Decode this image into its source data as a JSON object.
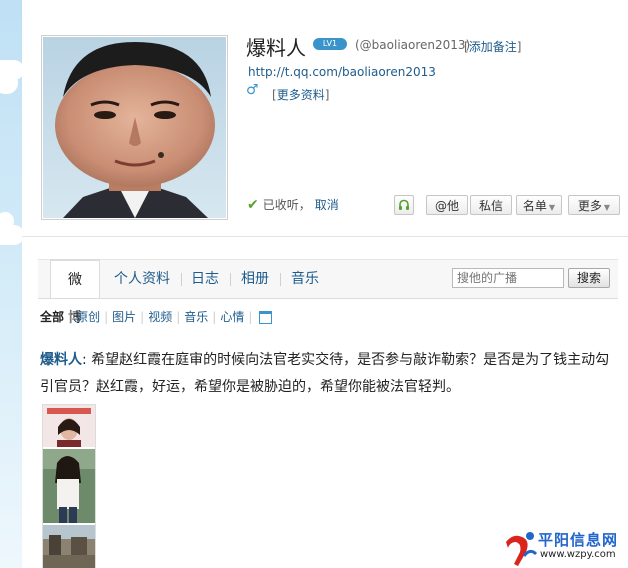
{
  "colors": {
    "link": "#1f5c8c",
    "accent": "#3a93c9",
    "check": "#5aa02c",
    "watermark_red": "#d9251d",
    "watermark_blue": "#2266cc"
  },
  "profile": {
    "name": "爆料人",
    "level_badge": "LV1",
    "handle": "(@baoliaoren2013)",
    "add_note_open": "[",
    "add_note_label": "添加备注",
    "add_note_close": "]",
    "url": "http://t.qq.com/baoliaoren2013",
    "gender_icon": "male-icon",
    "gender_glyph": "♂",
    "more_info_open": "[",
    "more_info_label": "更多资料",
    "more_info_close": "]"
  },
  "actions": {
    "follow_status": "已收听，",
    "cancel_label": "取消",
    "listen_icon": "headphones-icon",
    "at_label": "@他",
    "message_label": "私信",
    "list_label": "名单",
    "more_label": "更多",
    "caret": "▼"
  },
  "tabs": [
    {
      "label": "微博",
      "active": true
    },
    {
      "label": "个人资料",
      "active": false
    },
    {
      "label": "日志",
      "active": false
    },
    {
      "label": "相册",
      "active": false
    },
    {
      "label": "音乐",
      "active": false
    }
  ],
  "search": {
    "placeholder": "搜他的广播",
    "button_label": "搜索"
  },
  "filters": [
    "全部",
    "原创",
    "图片",
    "视频",
    "音乐",
    "心情"
  ],
  "post": {
    "author": "爆料人",
    "separator": ":",
    "text": " 希望赵红霞在庭审的时候向法官老实交待，是否参与敲诈勒索？是否是为了钱主动勾引官员？赵红霞，好运，希望你是被胁迫的，希望你能被法官轻判。"
  },
  "watermark": {
    "name": "平阳信息网",
    "url": "www.wzpy.com"
  }
}
